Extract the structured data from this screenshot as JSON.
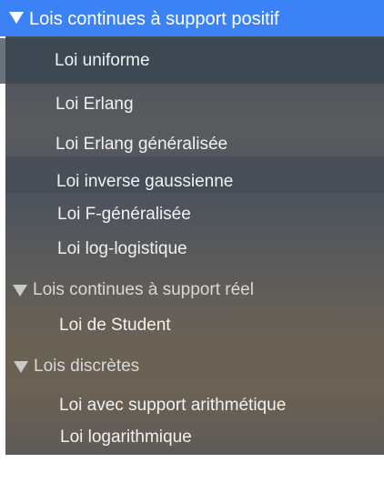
{
  "tree": {
    "groups": [
      {
        "label": "Lois continues à support positif",
        "expanded": true,
        "selected": true,
        "items": [
          {
            "label": "Loi uniforme",
            "highlighted": true
          },
          {
            "label": "Loi Erlang"
          },
          {
            "label": "Loi Erlang généralisée"
          },
          {
            "label": "Loi inverse gaussienne"
          },
          {
            "label": "Loi F-généralisée"
          },
          {
            "label": "Loi log-logistique"
          }
        ]
      },
      {
        "label": "Lois continues à support réel",
        "expanded": true,
        "items": [
          {
            "label": "Loi de Student"
          }
        ]
      },
      {
        "label": "Lois discrètes",
        "expanded": true,
        "items": [
          {
            "label": "Loi avec support arithmétique"
          },
          {
            "label": "Loi logarithmique"
          }
        ]
      }
    ]
  },
  "colors": {
    "selection": "#3b82f6",
    "highlight_row": "#3a4652",
    "text": "#f1f1f1"
  }
}
